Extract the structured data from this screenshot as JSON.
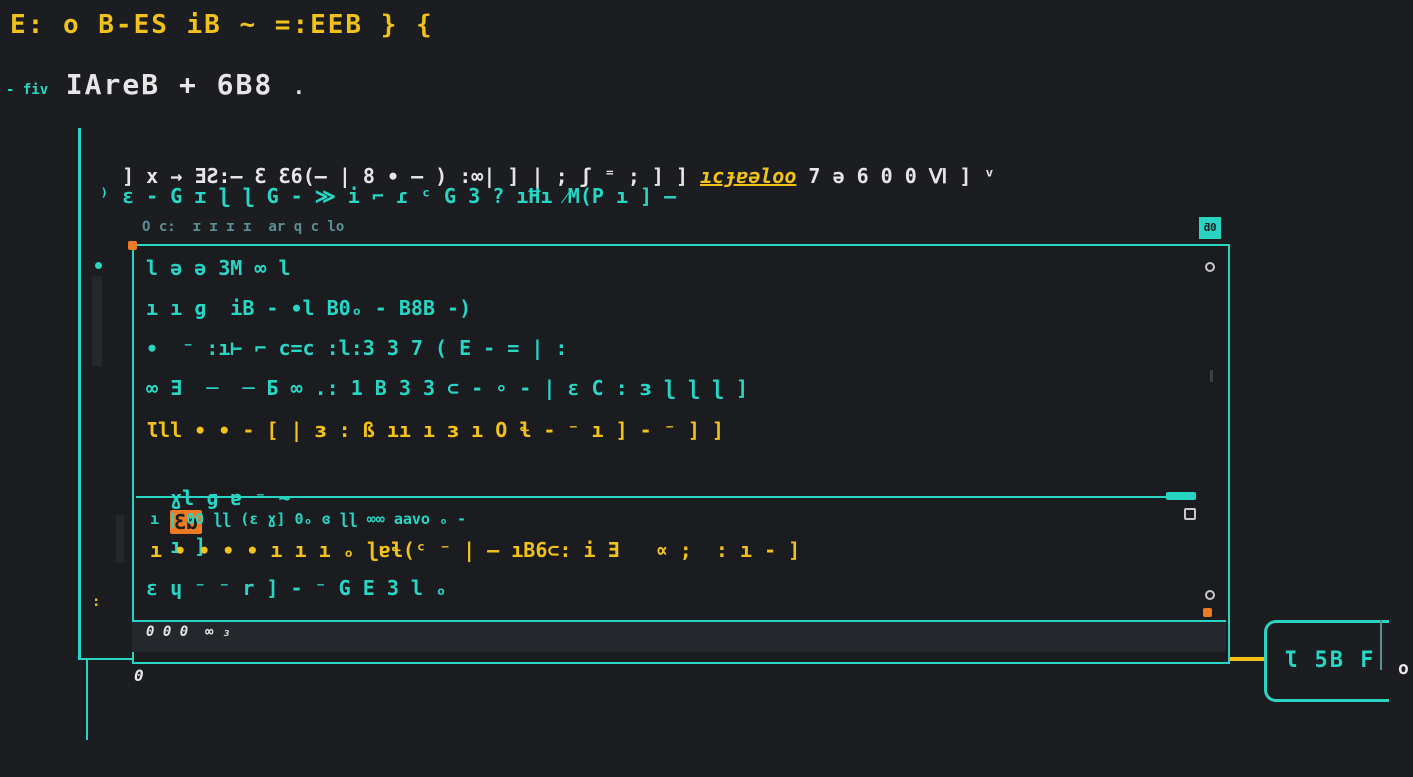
{
  "header": {
    "title": "E: o B-ES iB ~ =:EEB } {"
  },
  "breadcrumb": {
    "prefix": "- fiv",
    "label": "IAreB + 6B8",
    "suffix": "."
  },
  "toolbar": {
    "line1": "] x → ƎƧ:— Ɛ Ɛ6(— | 8 ∙ — ) :∞| ] | ; ʃ ⁼ ; ] ] ",
    "link": "ıcɟɐəloo",
    "line1_tail": " 7 ə 6 0 0 Ⅵ ] ᵛ",
    "line2": "⁾ ɛ - G ɪ ɭ ɭ G - ≫ i ⌐ ɾ ᶜ G 3 ? ıĦı ⁄M(P ı ] —"
  },
  "panel": {
    "caption": "O c:  ɪ ɪ ɪ ɪ  ar q c lo",
    "badge": "ƌ0",
    "rows": [
      {
        "text": "l ə ə 3M ∞ l",
        "color": "teal"
      },
      {
        "text": "ı ı ɡ  iB - ∙l B0ₒ - B8B -)",
        "color": "teal"
      },
      {
        "text": "∙  ⁻ :ı⊢ ⌐ c=c :l:3 3 7 ( E - = | :",
        "color": "teal"
      },
      {
        "text": "∞ Ǝ  ─  ─ Б ∞ .: 1 B 3 3 ⊂ - ∘ - | ɛ C : ɜ ɭ ɭ ɭ ]",
        "color": "teal"
      },
      {
        "text": "Ɩll ∙ ∙ - [ | ɜ : ß ıı ı ɜ ı O ɬ - ⁻ ı ] - ⁻ ] ]",
        "color": "yellow"
      },
      {
        "text": "ɣl ɡ ɐ ⁻ ~",
        "color": "teal"
      }
    ],
    "row6_tag": "Ɛɒ",
    "row6_tail": "ı ]",
    "console": [
      {
        "text": "ı | 00 ɭɭ (ɛ ɣ] 0ₒ ɞ ɭɭ ∞∞ aavo ₒ -",
        "color": "teal"
      },
      {
        "text": "ı ∙ ∙ ∙ ∙ ı ı ı ₒ ɭɐɬ(ᶜ ⁻ | — ıB6⊂: i Ǝ   ∝ ;  : ı - ]",
        "color": "yellow"
      },
      {
        "text": "ɛ ɥ ⁻ ⁻ r ] - ⁻ G E 3 l ₒ",
        "color": "teal"
      }
    ],
    "footer": "0 0 0  ∞ ₃"
  },
  "status": {
    "left_marker": "0",
    "counter_value": "Ɩ 5B F",
    "counter_side": "o"
  },
  "colors": {
    "teal": "#2ad4c2",
    "yellow": "#f2c21a",
    "orange": "#f07a24",
    "background": "#1b1d21"
  }
}
